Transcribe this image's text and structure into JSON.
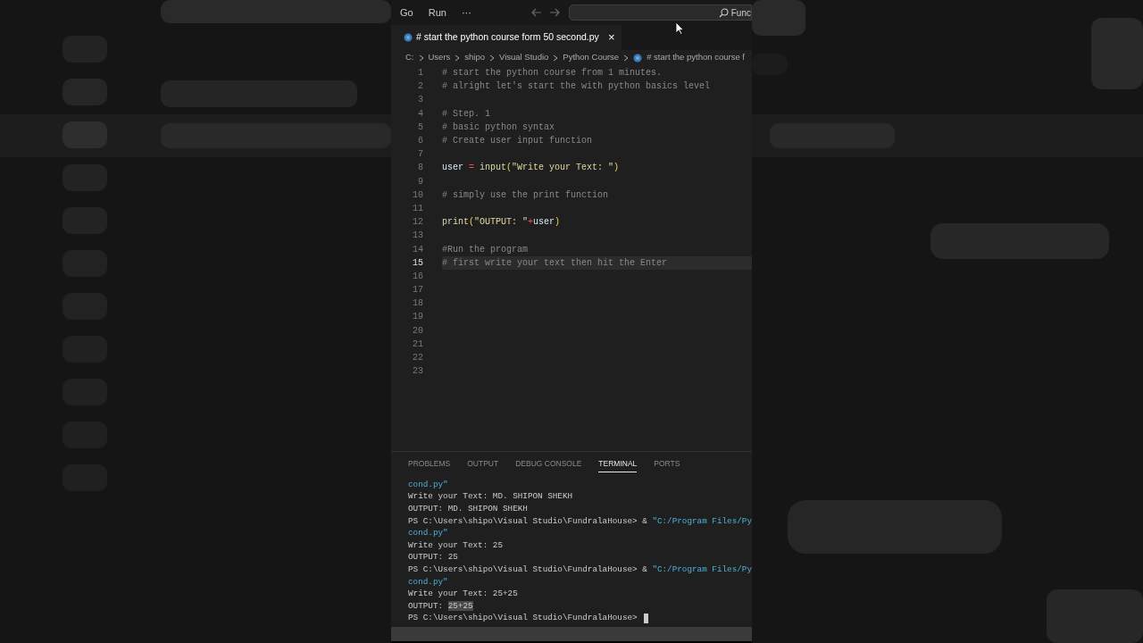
{
  "title_bar": {
    "menu": [
      "Go",
      "Run",
      "···"
    ],
    "search": {
      "value": "Func"
    }
  },
  "tabs": [
    {
      "label": "# start the python course form 50 second.py",
      "close": "×",
      "selected": true
    }
  ],
  "breadcrumb": [
    "C:",
    "Users",
    "shipo",
    "Visual Studio",
    "Python Course",
    "# start the python course f"
  ],
  "editor": {
    "lines": [
      {
        "number": "1",
        "selected": false,
        "segments": [
          {
            "kind": "comment",
            "text": "# start the python course from 1 minutes."
          }
        ]
      },
      {
        "number": "2",
        "selected": false,
        "segments": [
          {
            "kind": "comment",
            "text": "# alright let's start the with python basics level"
          }
        ]
      },
      {
        "number": "3",
        "selected": false
      },
      {
        "number": "4",
        "selected": false,
        "segments": [
          {
            "kind": "comment",
            "text": "# Step. 1"
          }
        ]
      },
      {
        "number": "5",
        "selected": false,
        "segments": [
          {
            "kind": "comment",
            "text": "# basic python syntax"
          }
        ]
      },
      {
        "number": "6",
        "selected": false,
        "segments": [
          {
            "kind": "comment",
            "text": "# Create user input function"
          }
        ]
      },
      {
        "number": "7",
        "selected": false
      },
      {
        "number": "8",
        "selected": false,
        "segments": [
          {
            "kind": "var",
            "text": "user"
          },
          {
            "kind": "op",
            "text": " = "
          },
          {
            "kind": "func",
            "text": "input"
          },
          {
            "kind": "punct",
            "text": "("
          },
          {
            "kind": "string",
            "text": "\"Write your Text: \""
          },
          {
            "kind": "punct",
            "text": ")"
          }
        ]
      },
      {
        "number": "9",
        "selected": false
      },
      {
        "number": "10",
        "selected": false,
        "segments": [
          {
            "kind": "comment",
            "text": "# simply use the print function"
          }
        ]
      },
      {
        "number": "11",
        "selected": false
      },
      {
        "number": "12",
        "selected": false,
        "segments": [
          {
            "kind": "func",
            "text": "print"
          },
          {
            "kind": "punct",
            "text": "("
          },
          {
            "kind": "string",
            "text": "\"OUTPUT: \""
          },
          {
            "kind": "op",
            "text": "+"
          },
          {
            "kind": "var",
            "text": "user"
          },
          {
            "kind": "punct",
            "text": ")"
          }
        ]
      },
      {
        "number": "13",
        "selected": false
      },
      {
        "number": "14",
        "selected": false,
        "segments": [
          {
            "kind": "comment",
            "text": "#Run the program"
          }
        ]
      },
      {
        "number": "15",
        "selected": true,
        "segments": [
          {
            "kind": "comment",
            "text": "# first write your text then hit the Enter"
          }
        ]
      },
      {
        "number": "16",
        "selected": false
      },
      {
        "number": "17",
        "selected": false
      },
      {
        "number": "18",
        "selected": false
      },
      {
        "number": "19",
        "selected": false
      },
      {
        "number": "20",
        "selected": false
      },
      {
        "number": "21",
        "selected": false
      },
      {
        "number": "22",
        "selected": false
      },
      {
        "number": "23",
        "selected": false
      }
    ]
  },
  "panel": {
    "tabs": [
      {
        "label": "PROBLEMS",
        "selected": false
      },
      {
        "label": "OUTPUT",
        "selected": false
      },
      {
        "label": "DEBUG CONSOLE",
        "selected": false
      },
      {
        "label": "TERMINAL",
        "selected": true
      },
      {
        "label": "PORTS",
        "selected": false
      }
    ],
    "terminal": [
      [
        {
          "kind": "string",
          "text": "cond.py\""
        }
      ],
      [
        {
          "kind": "plain",
          "text": "Write your Text: MD. SHIPON SHEKH"
        }
      ],
      [
        {
          "kind": "plain",
          "text": "OUTPUT: MD. SHIPON SHEKH"
        }
      ],
      [
        {
          "kind": "plain",
          "text": "PS C:\\Users\\shipo\\Visual Studio\\FundralaHouse> & "
        },
        {
          "kind": "string",
          "text": "\"C:/Program Files/Py"
        }
      ],
      [
        {
          "kind": "string",
          "text": "cond.py\""
        }
      ],
      [
        {
          "kind": "plain",
          "text": "Write your Text: 25"
        }
      ],
      [
        {
          "kind": "plain",
          "text": "OUTPUT: 25"
        }
      ],
      [
        {
          "kind": "plain",
          "text": "PS C:\\Users\\shipo\\Visual Studio\\FundralaHouse> & "
        },
        {
          "kind": "string",
          "text": "\"C:/Program Files/Py"
        }
      ],
      [
        {
          "kind": "string",
          "text": "cond.py\""
        }
      ],
      [
        {
          "kind": "plain",
          "text": "Write your Text: 25+25"
        }
      ],
      [
        {
          "kind": "plain",
          "text": "OUTPUT: "
        },
        {
          "kind": "highlight",
          "text": "25+25"
        }
      ],
      [
        {
          "kind": "plain",
          "text": "PS C:\\Users\\shipo\\Visual Studio\\FundralaHouse> "
        },
        {
          "kind": "cursor"
        }
      ]
    ]
  }
}
